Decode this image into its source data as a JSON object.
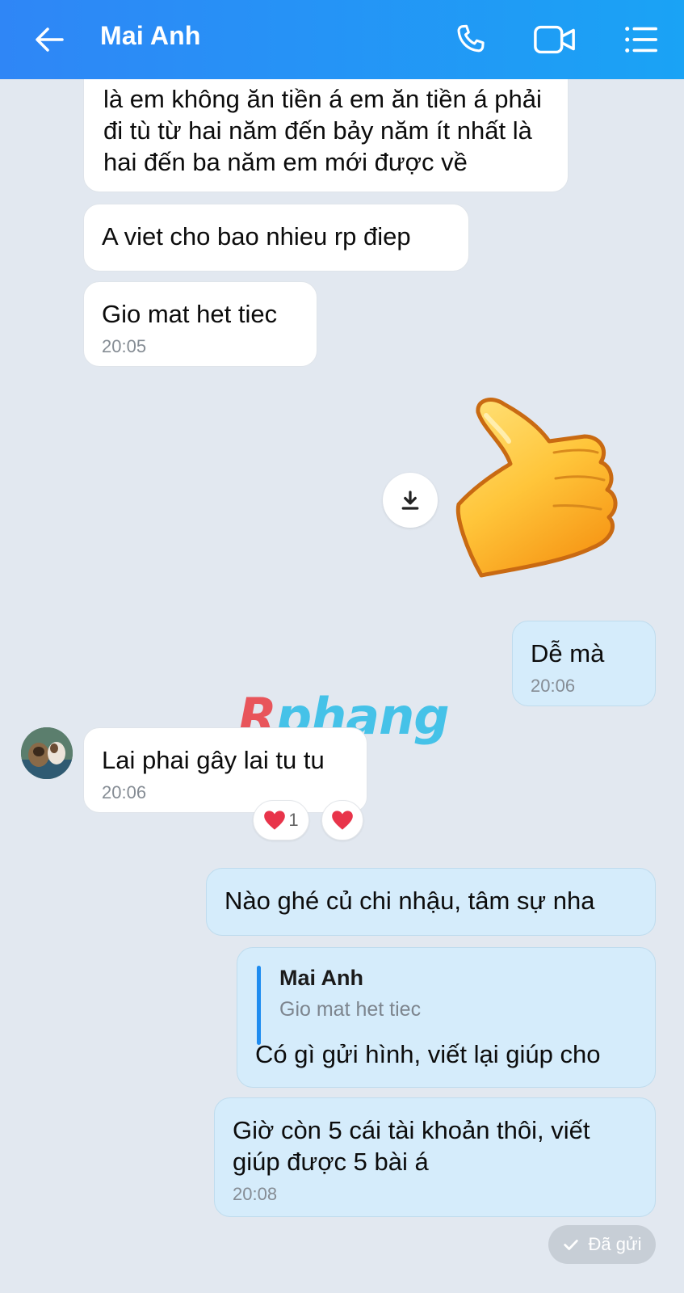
{
  "header": {
    "title": "Mai Anh",
    "icons": [
      "back-arrow-icon",
      "phone-icon",
      "video-call-icon",
      "menu-list-icon"
    ]
  },
  "messages": {
    "m1": {
      "lines": [
        "là em không ăn tiền á em ăn tiền á phải",
        "đi tù từ hai năm đến bảy năm ít nhất là",
        "hai đến ba năm em mới được về"
      ]
    },
    "m2": {
      "text": "A viet cho bao nhieu rp điep"
    },
    "m3": {
      "text": "Gio mat het tiec",
      "time": "20:05"
    },
    "m4": {
      "text": "Dễ mà",
      "time": "20:06"
    },
    "m5": {
      "text": "Lai phai gây lai tu tu",
      "time": "20:06",
      "reaction_count": "1"
    },
    "m6": {
      "text": "Nào ghé củ chi nhậu, tâm sự nha"
    },
    "m7": {
      "quote_author": "Mai Anh",
      "quote_text": "Gio mat het tiec",
      "text": "Có gì gửi hình, viết lại giúp cho"
    },
    "m8": {
      "lines": [
        "Giờ còn 5 cái tài khoản thôi, viết",
        "giúp được 5 bài á"
      ],
      "time": "20:08"
    }
  },
  "sticker": {
    "icon": "thumbs-up-sticker-icon",
    "download_icon": "download-icon"
  },
  "watermark": {
    "r": "R",
    "rest": "phang"
  },
  "status": {
    "label": "Đã gửi",
    "icon": "check-icon"
  },
  "colors": {
    "header_start": "#2f86f6",
    "header_end": "#1aa3f5",
    "background": "#e2e8f0",
    "outgoing_bubble": "#d5ecfb",
    "incoming_bubble": "#ffffff",
    "heart": "#e8344a"
  }
}
